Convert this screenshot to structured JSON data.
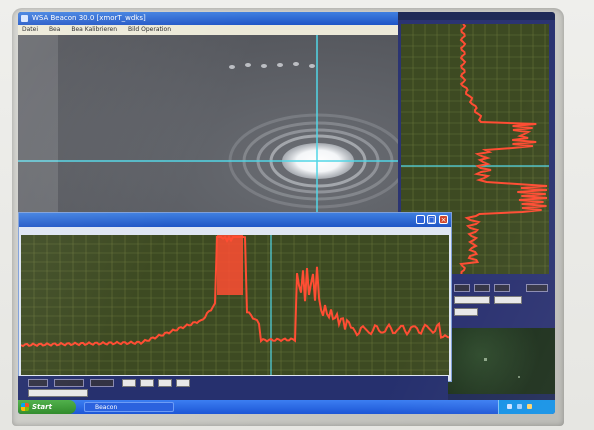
{
  "main_window": {
    "title": "WSA Beacon 30.0 [xmorT_wdks]",
    "menu": [
      "Datei",
      "Bea",
      "Bea Kalibrieren",
      "Bild Operation"
    ]
  },
  "profile_window": {
    "title": ""
  },
  "bottom_panel": {
    "buttons": [
      "",
      "",
      ""
    ]
  },
  "taskbar": {
    "start_label": "Start",
    "task_label": "Beacon"
  },
  "colors": {
    "plot_bg": "#3d4a22",
    "plot_grid": "#6f7a3e",
    "trace": "#ff4d33",
    "crosshair": "#52d6e6",
    "screen_bg": "#1f2a57",
    "titlebar": "#2456d1"
  },
  "icons": {
    "close": "close-icon",
    "maximize": "maximize-icon",
    "minimize": "minimize-icon",
    "windows_logo": "windows-logo-icon"
  }
}
